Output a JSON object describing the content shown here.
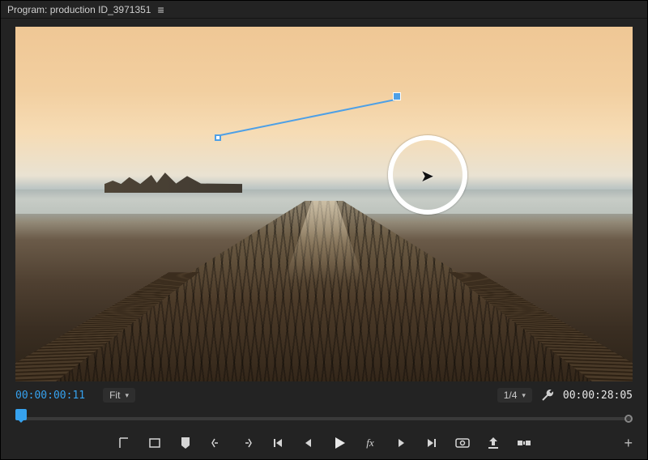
{
  "panel": {
    "title_prefix": "Program:",
    "sequence_name": "production ID_3971351"
  },
  "overlay": {
    "cursor_ring_visible": true,
    "motion_path_visible": true
  },
  "transport": {
    "current_timecode": "00:00:00:11",
    "sequence_out_timecode": "00:00:28:05",
    "zoom_label": "Fit",
    "scale_label": "1/4"
  },
  "tray": {
    "buttons": [
      "in-point-icon",
      "out-point-icon",
      "add-marker-icon",
      "mark-in-icon",
      "mark-out-icon",
      "go-to-in-icon",
      "step-back-icon",
      "play-icon",
      "fx-icon",
      "step-forward-icon",
      "go-to-out-icon",
      "export-frame-icon",
      "lift-icon",
      "extract-icon"
    ],
    "add_button_label": "+"
  },
  "icons": {
    "menu": "≡",
    "chevron_down": "▾",
    "plus": "+"
  }
}
